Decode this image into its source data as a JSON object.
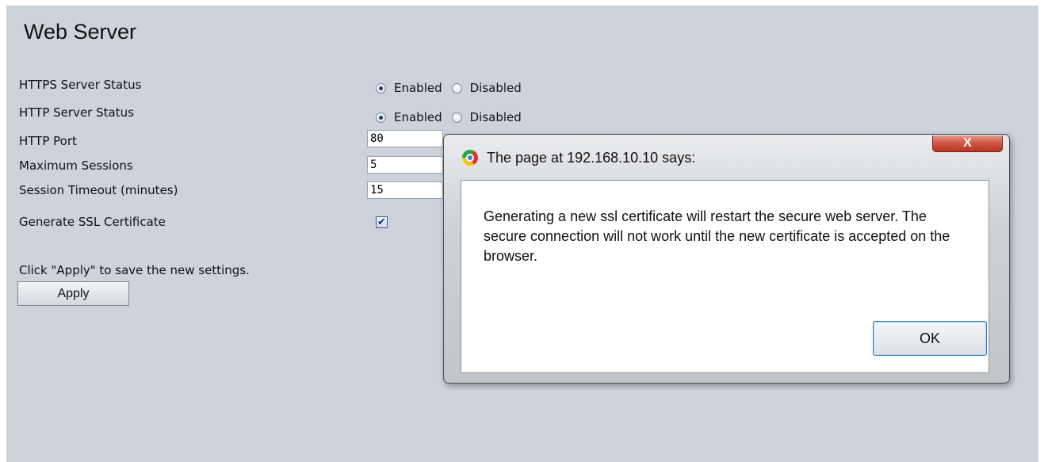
{
  "page": {
    "title": "Web Server"
  },
  "form": {
    "https_status": {
      "label": "HTTPS Server Status",
      "options": [
        "Enabled",
        "Disabled"
      ],
      "selected": "Enabled"
    },
    "http_status": {
      "label": "HTTP Server Status",
      "options": [
        "Enabled",
        "Disabled"
      ],
      "selected": "Enabled"
    },
    "http_port": {
      "label": "HTTP Port",
      "value": "80"
    },
    "max_sessions": {
      "label": "Maximum Sessions",
      "value": "5"
    },
    "session_timeout": {
      "label": "Session Timeout (minutes)",
      "value": "15"
    },
    "generate_ssl": {
      "label": "Generate SSL Certificate",
      "checked": true
    },
    "apply_hint": "Click \"Apply\" to save the new settings.",
    "apply_label": "Apply"
  },
  "dialog": {
    "title": "The page at 192.168.10.10 says:",
    "close_label": "X",
    "message": "Generating a new ssl certificate will restart the secure web server. The secure connection will not work until the new certificate is accepted on the browser.",
    "ok_label": "OK"
  },
  "icons": {
    "browser": "chrome-icon",
    "close": "close-icon",
    "check": "checkmark-icon"
  },
  "colors": {
    "page_background": "#ccd3db",
    "close_button": "#c94f3c",
    "ok_button_border": "#3c7fb1"
  }
}
